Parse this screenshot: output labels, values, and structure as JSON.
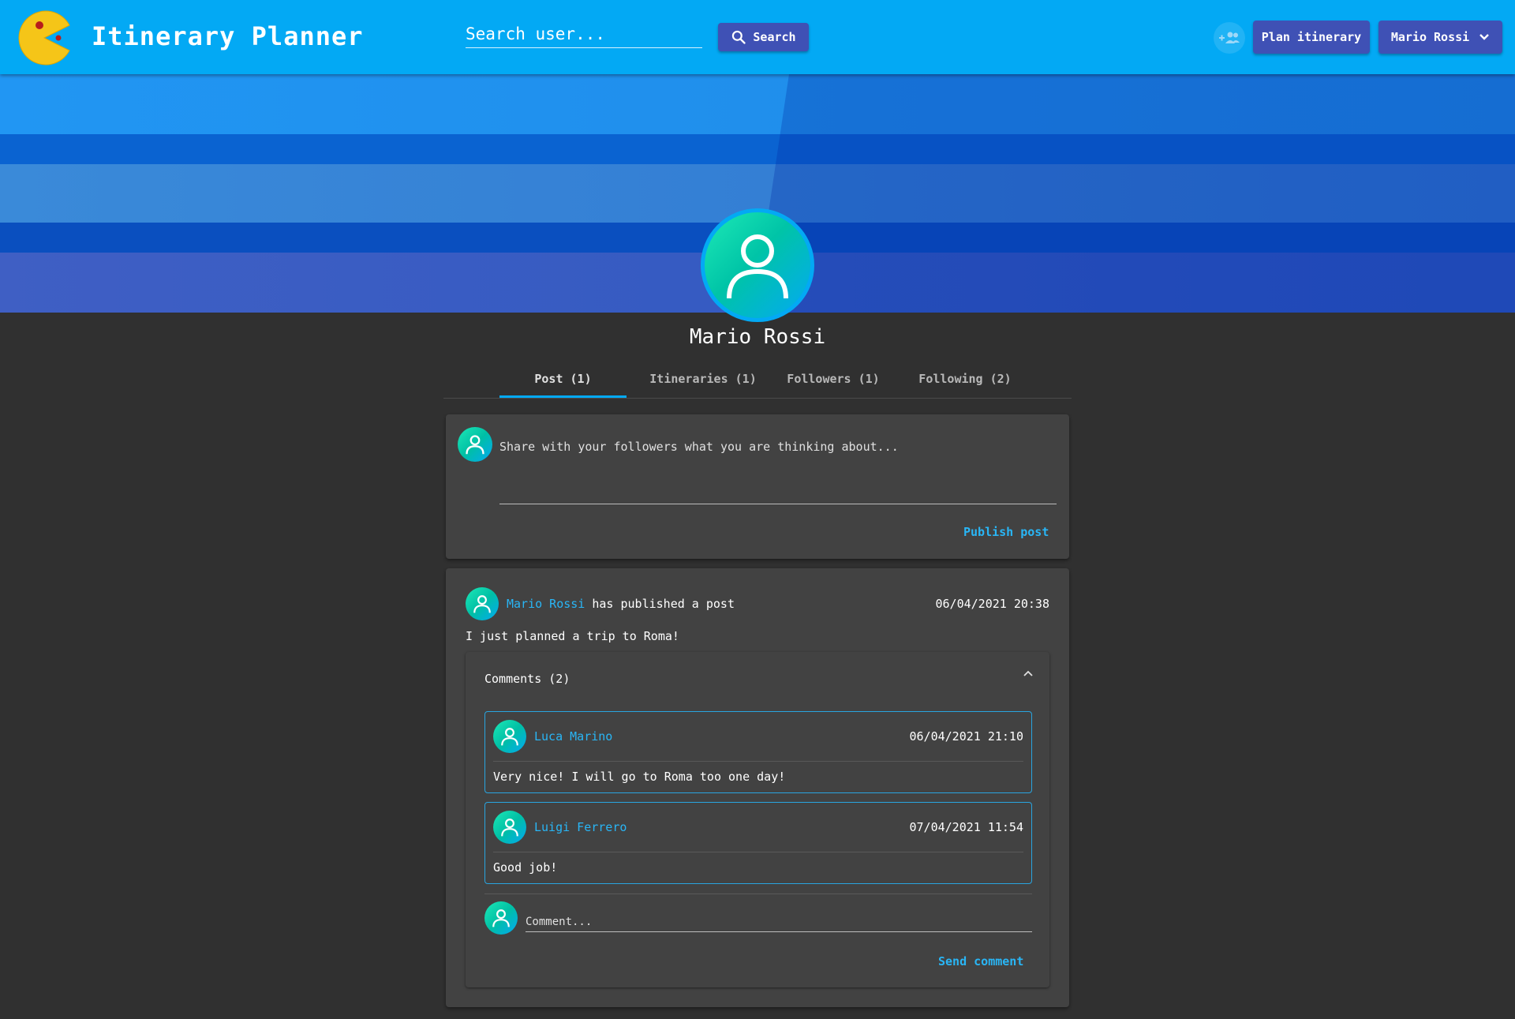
{
  "header": {
    "app_title": "Itinerary Planner",
    "search_placeholder": "Search user...",
    "search_button": "Search",
    "plan_button": "Plan itinerary",
    "user_menu": "Mario Rossi"
  },
  "profile": {
    "name": "Mario Rossi",
    "tabs": [
      {
        "label": "Post (1)",
        "active": true
      },
      {
        "label": "Itineraries (1)",
        "active": false
      },
      {
        "label": "Followers (1)",
        "active": false
      },
      {
        "label": "Following (2)",
        "active": false
      }
    ]
  },
  "composer": {
    "placeholder": "Share with your followers what you are thinking about...",
    "publish_label": "Publish post"
  },
  "post": {
    "author": "Mario Rossi",
    "action": "has published a post",
    "timestamp": "06/04/2021 20:38",
    "text": "I just planned a trip to Roma!",
    "comments_label": "Comments (2)",
    "comments": [
      {
        "author": "Luca Marino",
        "timestamp": "06/04/2021 21:10",
        "text": "Very nice! I will go to Roma too one day!"
      },
      {
        "author": "Luigi Ferrero",
        "timestamp": "07/04/2021 11:54",
        "text": "Good job!"
      }
    ],
    "comment_placeholder": "Comment...",
    "send_label": "Send comment"
  },
  "colors": {
    "topbar": "#03a9f4",
    "accent": "#29b6f6",
    "indigo": "#3f51b5",
    "background": "#303030",
    "card": "#424242"
  }
}
